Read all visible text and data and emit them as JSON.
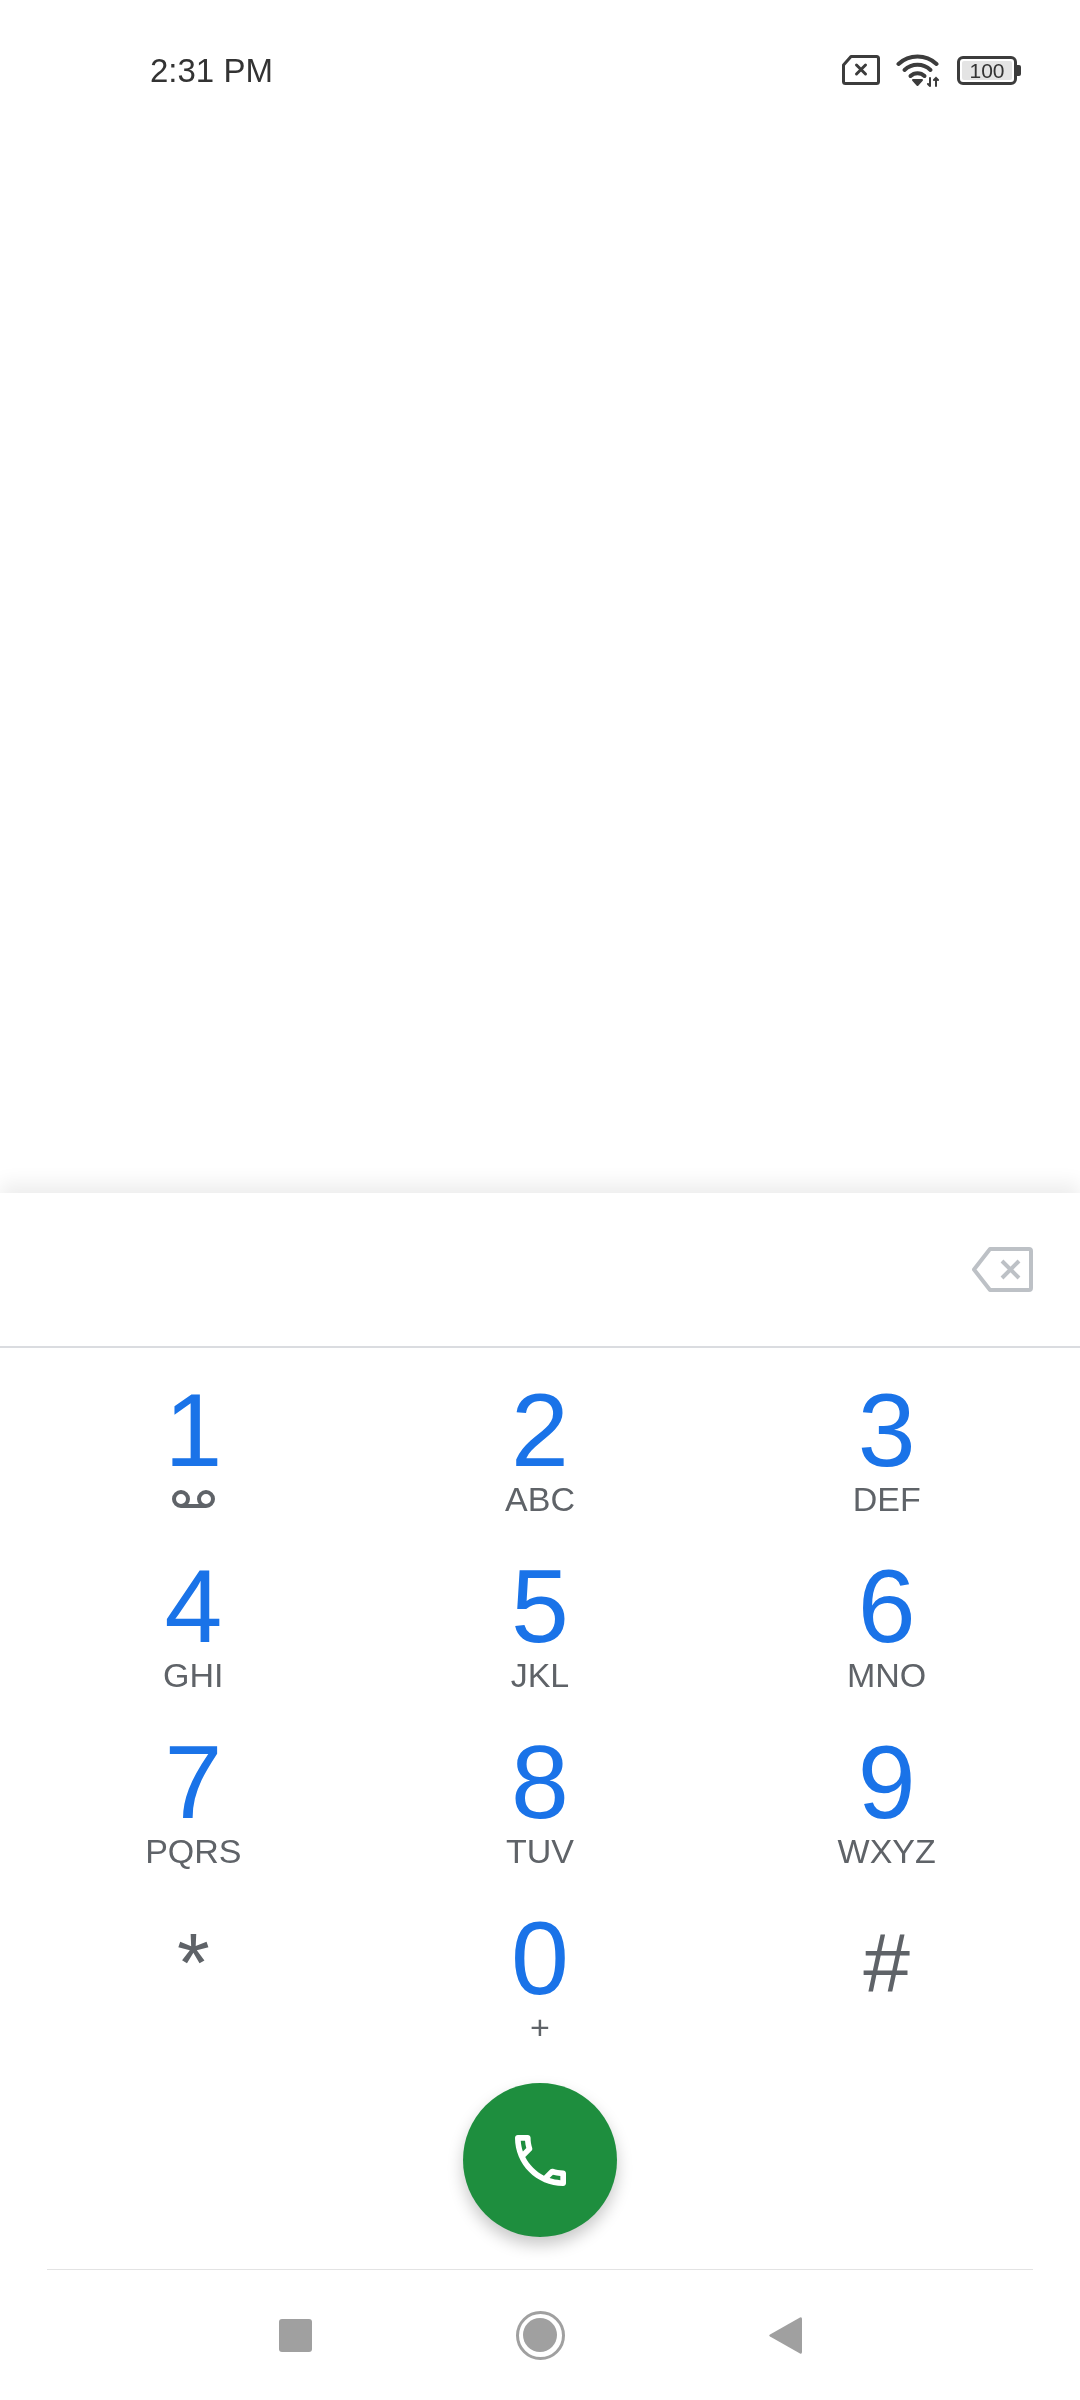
{
  "status_bar": {
    "time": "2:31 PM",
    "battery": "100"
  },
  "dialer": {
    "backspace": {
      "disabled": true
    },
    "keys": [
      {
        "kind": "voicemail",
        "label": "1"
      },
      {
        "kind": "letters",
        "label": "2",
        "letters": "ABC"
      },
      {
        "kind": "letters",
        "label": "3",
        "letters": "DEF"
      },
      {
        "kind": "letters",
        "label": "4",
        "letters": "GHI"
      },
      {
        "kind": "letters",
        "label": "5",
        "letters": "JKL"
      },
      {
        "kind": "letters",
        "label": "6",
        "letters": "MNO"
      },
      {
        "kind": "letters",
        "label": "7",
        "letters": "PQRS"
      },
      {
        "kind": "letters",
        "label": "8",
        "letters": "TUV"
      },
      {
        "kind": "letters",
        "label": "9",
        "letters": "WXYZ"
      },
      {
        "kind": "symbol",
        "label": "*"
      },
      {
        "kind": "letters",
        "label": "0",
        "letters": "+"
      },
      {
        "kind": "symbol",
        "label": "#"
      }
    ]
  }
}
